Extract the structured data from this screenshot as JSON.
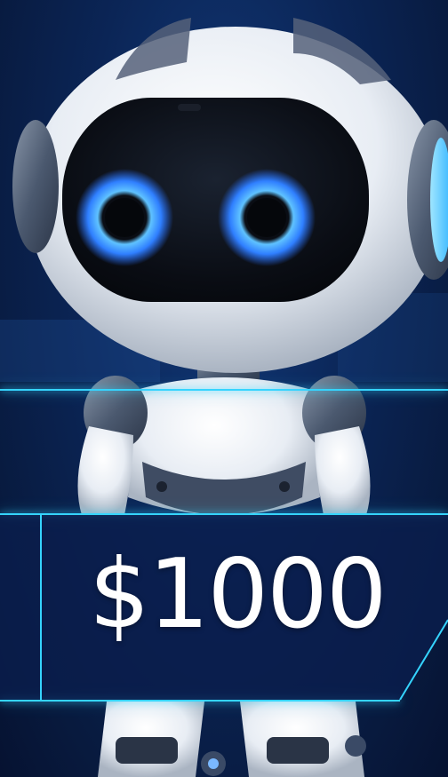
{
  "price": {
    "amount": "$1000"
  },
  "colors": {
    "background_dark": "#081a3e",
    "background_mid": "#0b2556",
    "accent_glow": "#35d4ff",
    "robot_eye_glow": "#3da0ff",
    "robot_shell": "#eef2f7",
    "robot_visor": "#0b0f18"
  },
  "image": {
    "subject_icon": "robot-icon"
  }
}
